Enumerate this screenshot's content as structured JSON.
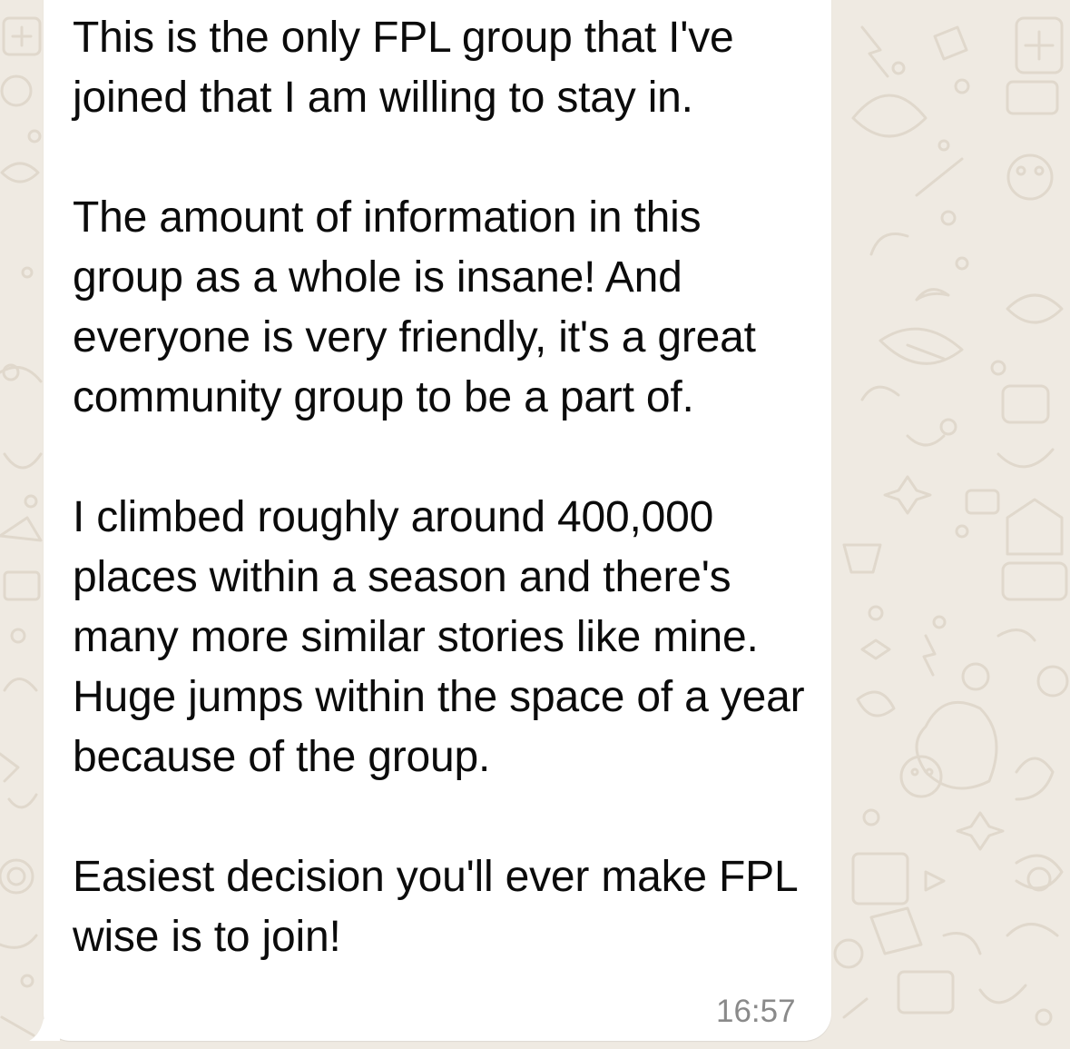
{
  "message": {
    "paragraphs": [
      "This is the only FPL group that I've joined that I am willing to stay in.",
      "The amount of information in this group as a whole is insane! And everyone is very friendly, it's a great community group to be a part of.",
      "I climbed roughly around 400,000 places within a season and there's many more similar stories like mine. Huge jumps within the space of a year because of the group.",
      "Easiest decision you'll ever make FPL wise is to join!"
    ],
    "time": "16:57"
  },
  "colors": {
    "wallpaper": "#efeae2",
    "doodles": "#e0d8cc",
    "bubble": "#ffffff",
    "text": "#0b0b0b",
    "timestamp": "#8a8a8a"
  },
  "icons": [
    "wallpaper-doodle-pattern"
  ]
}
